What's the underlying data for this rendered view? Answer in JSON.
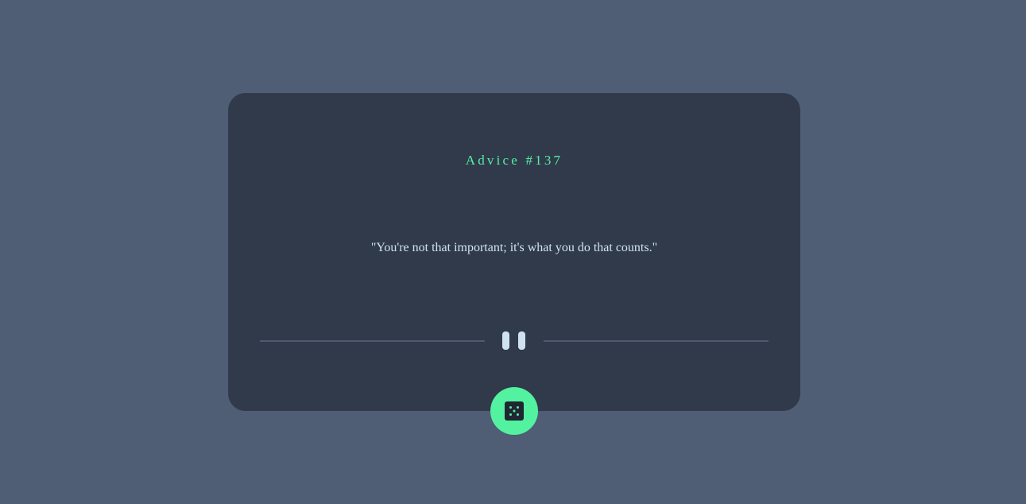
{
  "advice": {
    "title": "Advice #137",
    "quote": "\"You're not that important; it's what you do that counts.\""
  },
  "controls": {
    "divider_icon": "pause-icon",
    "button_icon": "dice-icon"
  },
  "colors": {
    "background": "#4f5d75",
    "card": "#313a4b",
    "accent": "#53f2a0",
    "text": "#cfe3ef"
  }
}
